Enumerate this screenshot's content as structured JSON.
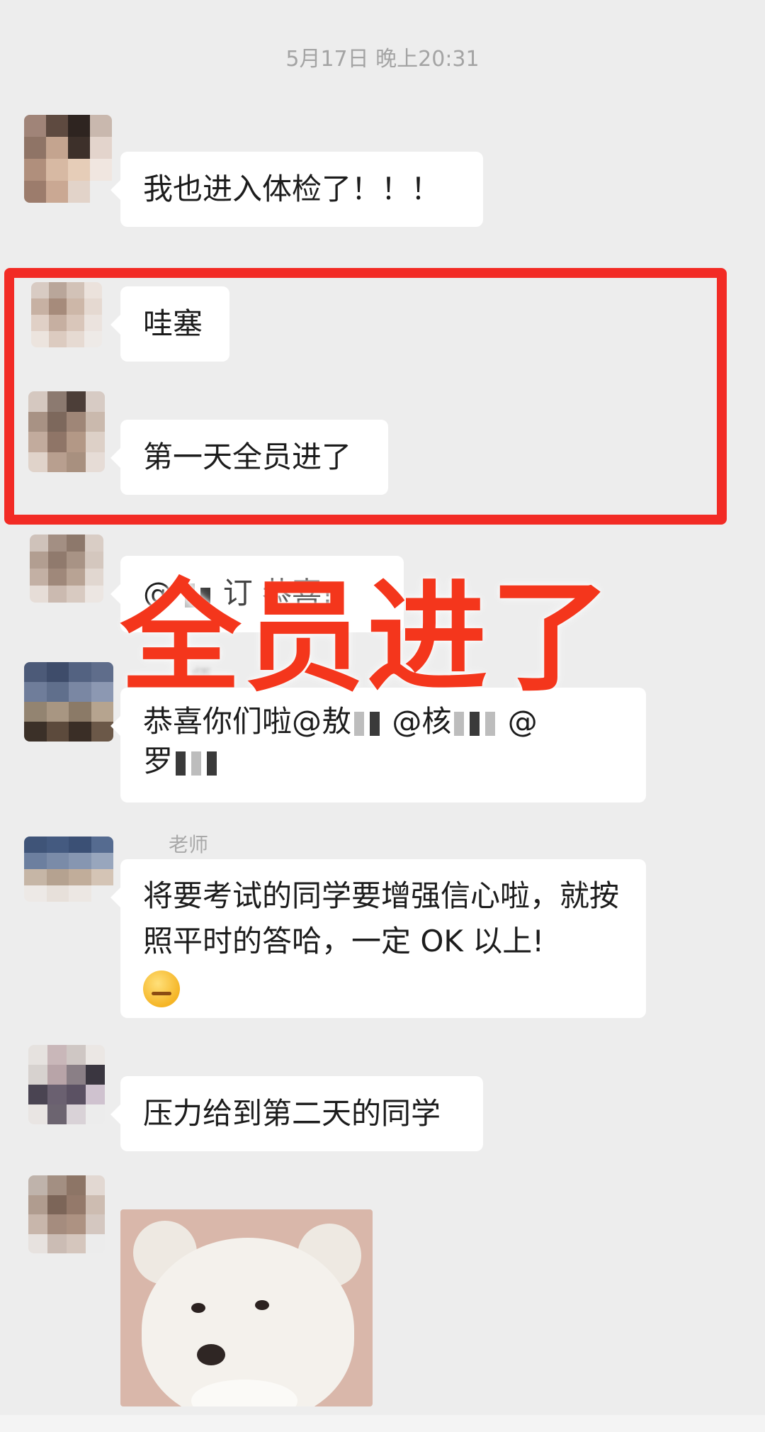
{
  "timestamp": "5月17日 晚上20:31",
  "messages": [
    {
      "sender": "",
      "text": "我也进入体检了！！！"
    },
    {
      "sender": "",
      "text": "哇塞"
    },
    {
      "sender": "",
      "text": "第一天全员进了"
    },
    {
      "sender": "",
      "text_visible_parts": [
        "@",
        "订",
        "恭喜!"
      ]
    },
    {
      "sender": "师",
      "text_line1_parts": [
        "恭喜你们啦@敖",
        "@核",
        "@"
      ],
      "text_line2_parts": [
        "罗"
      ]
    },
    {
      "sender": "老师",
      "text": "将要考试的同学要增强信心啦，就按照平时的答哈，一定 OK 以上!"
    },
    {
      "sender": "",
      "text": "压力给到第二天的同学"
    },
    {
      "sender": "",
      "type": "sticker"
    }
  ],
  "overlay_text": "全员进了",
  "colors": {
    "background": "#ededed",
    "bubble": "#ffffff",
    "highlight_border": "#f22b25",
    "overlay_text": "#f4361c"
  }
}
